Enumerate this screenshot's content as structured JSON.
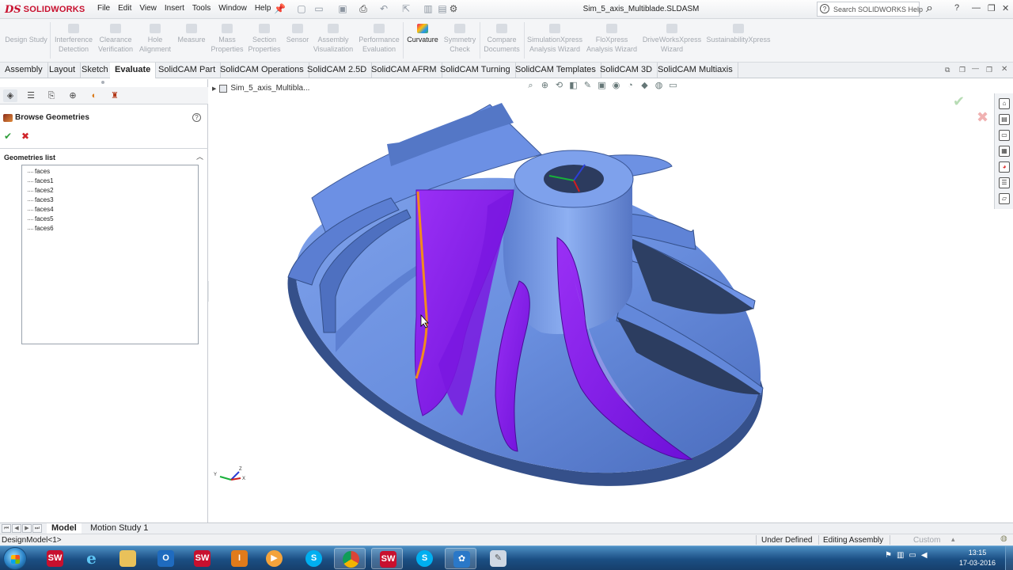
{
  "app": {
    "logo_mark": "DS",
    "logo_name": "SOLIDWORKS",
    "document_title": "Sim_5_axis_Multiblade.SLDASM",
    "search_placeholder": "Search SOLIDWORKS Help"
  },
  "menu": [
    "File",
    "Edit",
    "View",
    "Insert",
    "Tools",
    "Window",
    "Help"
  ],
  "commandmanager": {
    "design_study": "Design Study",
    "items": [
      {
        "label1": "Interference",
        "label2": "Detection",
        "active": false
      },
      {
        "label1": "Clearance",
        "label2": "Verification",
        "active": false
      },
      {
        "label1": "Hole",
        "label2": "Alignment",
        "active": false
      },
      {
        "label1": "Measure",
        "label2": "",
        "active": false
      },
      {
        "label1": "Mass",
        "label2": "Properties",
        "active": false
      },
      {
        "label1": "Section",
        "label2": "Properties",
        "active": false
      },
      {
        "label1": "Sensor",
        "label2": "",
        "active": false
      },
      {
        "label1": "Assembly",
        "label2": "Visualization",
        "active": false
      },
      {
        "label1": "Performance",
        "label2": "Evaluation",
        "active": false
      },
      {
        "label1": "Curvature",
        "label2": "",
        "active": true
      },
      {
        "label1": "Symmetry",
        "label2": "Check",
        "active": false
      },
      {
        "label1": "Compare",
        "label2": "Documents",
        "active": false
      },
      {
        "label1": "SimulationXpress",
        "label2": "Analysis Wizard",
        "active": false
      },
      {
        "label1": "FloXpress",
        "label2": "Analysis Wizard",
        "active": false
      },
      {
        "label1": "DriveWorksXpress",
        "label2": "Wizard",
        "active": false
      },
      {
        "label1": "SustainabilityXpress",
        "label2": "",
        "active": false
      }
    ]
  },
  "tabs": [
    {
      "label": "Assembly",
      "active": false
    },
    {
      "label": "Layout",
      "active": false
    },
    {
      "label": "Sketch",
      "active": false
    },
    {
      "label": "Evaluate",
      "active": true
    },
    {
      "label": "SolidCAM Part",
      "active": false
    },
    {
      "label": "SolidCAM Operations",
      "active": false
    },
    {
      "label": "SolidCAM 2.5D",
      "active": false
    },
    {
      "label": "SolidCAM AFRM",
      "active": false
    },
    {
      "label": "SolidCAM Turning",
      "active": false
    },
    {
      "label": "SolidCAM Templates",
      "active": false
    },
    {
      "label": "SolidCAM 3D",
      "active": false
    },
    {
      "label": "SolidCAM Multiaxis",
      "active": false
    }
  ],
  "property_manager": {
    "title": "Browse Geometries",
    "help": "?",
    "ok": "✔",
    "cancel": "✖",
    "section_title": "Geometries list",
    "geometries": [
      "faces",
      "faces1",
      "faces2",
      "faces3",
      "faces4",
      "faces5",
      "faces6"
    ]
  },
  "viewport": {
    "breadcrumb": "Sim_5_axis_Multibla...",
    "triad_labels": {
      "x": "X",
      "y": "Y",
      "z": "Z"
    },
    "colors": {
      "body": "#6b90e0",
      "highlight": "#8a1ff0",
      "edge": "#f28a1e",
      "shadow": "#3a5288"
    }
  },
  "bottom_tabs": [
    {
      "label": "Model",
      "active": true
    },
    {
      "label": "Motion Study 1",
      "active": false
    }
  ],
  "status": {
    "left": "DesignModel<1>",
    "state1": "Under Defined",
    "state2": "Editing Assembly",
    "units": "Custom"
  },
  "taskbar": {
    "apps": [
      "solidworks-2015",
      "internet-explorer",
      "file-explorer",
      "outlook",
      "solidworks-2016",
      "solidworks-pro",
      "media-player",
      "skype",
      "chrome",
      "solidworks-2016-active",
      "skype-2",
      "network-app",
      "paint"
    ],
    "time": "13:15",
    "date": "17-03-2016"
  }
}
